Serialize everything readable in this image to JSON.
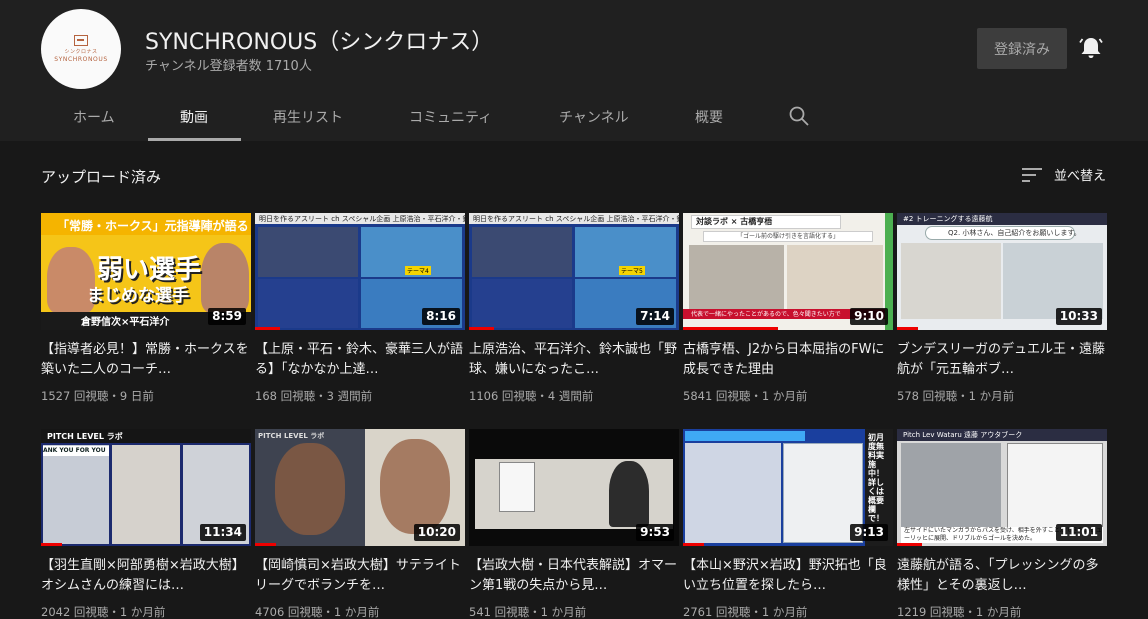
{
  "channel": {
    "name": "SYNCHRONOUS（シンクロナス）",
    "subscribers": "チャンネル登録者数 1710人",
    "subscribe_button": "登録済み",
    "avatar_text_small": "シンクロナス",
    "avatar_text_large": "SYNCHRONOUS"
  },
  "tabs": [
    {
      "label": "ホーム",
      "active": false
    },
    {
      "label": "動画",
      "active": true
    },
    {
      "label": "再生リスト",
      "active": false
    },
    {
      "label": "コミュニティ",
      "active": false
    },
    {
      "label": "チャンネル",
      "active": false
    },
    {
      "label": "概要",
      "active": false
    }
  ],
  "section": {
    "title": "アップロード済み",
    "sort_label": "並べ替え"
  },
  "videos": [
    {
      "title": "【指導者必見！】常勝・ホークスを築いた二人のコーチ…",
      "meta": "1527 回視聴・9 日前",
      "duration": "8:59",
      "progress": 0.0,
      "thumb_text": {
        "cap": "「常勝・ホークス」元指導陣が語る",
        "big1": "弱い選手",
        "big2": "まじめな選手",
        "names": "倉野信次×平石洋介"
      }
    },
    {
      "title": "【上原・平石・鈴木、豪華三人が語る】「なかなか上達…",
      "meta": "168 回視聴・3 週間前",
      "duration": "8:16",
      "progress": 0.12,
      "thumb_text": {
        "header": "明日を作るアスリート ch スペシャル企画 上原浩治・平石洋介・鈴木誠也",
        "tag": "テーマ4"
      }
    },
    {
      "title": "上原浩治、平石洋介、鈴木誠也「野球、嫌いになったこ…",
      "meta": "1106 回視聴・4 週間前",
      "duration": "7:14",
      "progress": 0.12,
      "thumb_text": {
        "header": "明日を作るアスリート ch スペシャル企画 上原浩治・平石洋介・鈴木誠也",
        "tag": "テーマ5"
      }
    },
    {
      "title": "古橋亨梧、J2から日本屈指のFWに成長できた理由",
      "meta": "5841 回視聴・1 か月前",
      "duration": "9:10",
      "progress": 0.45,
      "thumb_text": {
        "header": "対談ラボ × 古橋亨梧",
        "sub": "「ゴール前の駆け引きを言語化する」",
        "red": "代表で一緒にやったことがあるので、色々聞きたい方で"
      }
    },
    {
      "title": "ブンデスリーガのデュエル王・遠藤航が「元五輪ボブ…",
      "meta": "578 回視聴・1 か月前",
      "duration": "10:33",
      "progress": 0.1,
      "thumb_text": {
        "header": "#2 トレーニングする遠藤航",
        "bubble": "Q2. 小林さん、自己紹介をお願いします。"
      }
    },
    {
      "title": "【羽生直剛×阿部勇樹×岩政大樹】オシムさんの練習には…",
      "meta": "2042 回視聴・1 か月前",
      "duration": "11:34",
      "progress": 0.1,
      "thumb_text": {
        "banner": "PITCH LEVEL ラボ",
        "strip": "ANK YOU FOR YOU"
      }
    },
    {
      "title": "【岡崎慎司×岩政大樹】サテライトリーグでボランチを…",
      "meta": "4706 回視聴・1 か月前",
      "duration": "10:20",
      "progress": 0.1,
      "thumb_text": {
        "logo": "PITCH LEVEL ラボ"
      }
    },
    {
      "title": "【岩政大樹・日本代表解説】オマーン第1戦の失点から見…",
      "meta": "541 回視聴・1 か月前",
      "duration": "9:53",
      "progress": 0.0,
      "thumb_text": {}
    },
    {
      "title": "【本山×野沢×岩政】野沢拓也「良い立ち位置を探したら…",
      "meta": "2761 回視聴・1 か月前",
      "duration": "9:13",
      "progress": 0.1,
      "thumb_text": {
        "side": "初月度無料実施中！詳しくは概要欄で！"
      }
    },
    {
      "title": "遠藤航が語る、「プレッシングの多様性」とその裏返し…",
      "meta": "1219 回視聴・1 か月前",
      "duration": "11:01",
      "progress": 0.12,
      "thumb_text": {
        "header": "Pitch Lev Wataru 遠藤 アウタブーク",
        "cap": "左サイドにいたマンガラからパスを受け、相手を外すことができた。ヒューリッヒに展開、ドリブルからゴールを決めた。"
      }
    }
  ],
  "colors": {
    "background": "#181818",
    "header": "#202020",
    "progress": "#ee0000"
  },
  "icons": {
    "bell": "bell-icon",
    "search": "search-icon",
    "sort": "sort-icon"
  }
}
